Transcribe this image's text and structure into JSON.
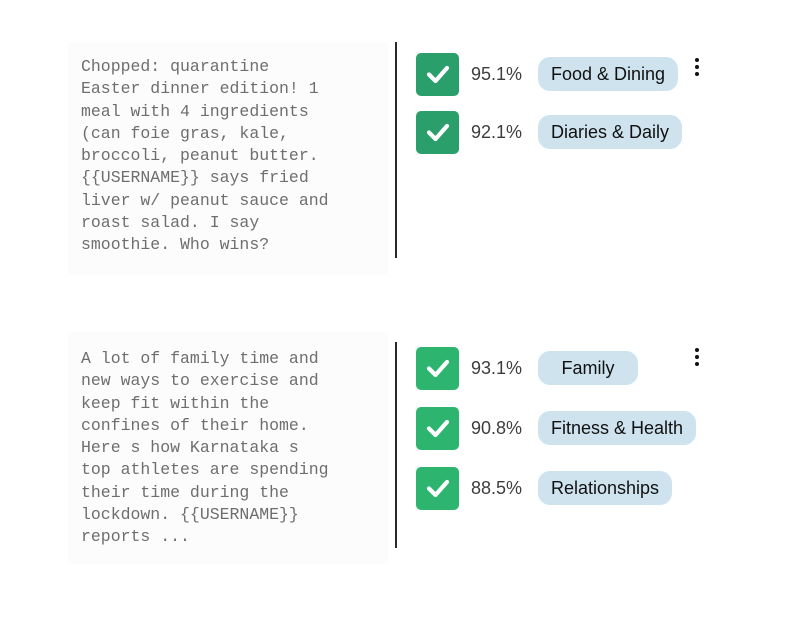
{
  "colors": {
    "check_green": "#2db56f",
    "check_green_dark": "#2a9e6b",
    "pill_blue": "#cfe3ef",
    "text_gray": "#6e6e6e"
  },
  "posts": [
    {
      "text": "Chopped: quarantine\nEaster dinner edition! 1\nmeal with 4 ingredients\n(can foie gras, kale,\nbroccoli, peanut butter.\n{{USERNAME}} says fried\nliver w/ peanut sauce and\nroast salad. I say\nsmoothie. Who wins?",
      "menu_icon": "more-vertical-icon",
      "labels": [
        {
          "score": "95.1%",
          "name": "Food & Dining",
          "check_icon": "check-icon"
        },
        {
          "score": "92.1%",
          "name": "Diaries & Daily",
          "check_icon": "check-icon"
        }
      ]
    },
    {
      "text": "A lot of family time and\nnew ways to exercise and\nkeep fit within the\nconfines of their home.\nHere s how Karnataka s\ntop athletes are spending\ntheir time during the\nlockdown. {{USERNAME}}\nreports ...",
      "menu_icon": "more-vertical-icon",
      "labels": [
        {
          "score": "93.1%",
          "name": "Family",
          "check_icon": "check-icon"
        },
        {
          "score": "90.8%",
          "name": "Fitness & Health",
          "check_icon": "check-icon"
        },
        {
          "score": "88.5%",
          "name": "Relationships",
          "check_icon": "check-icon"
        }
      ]
    }
  ]
}
